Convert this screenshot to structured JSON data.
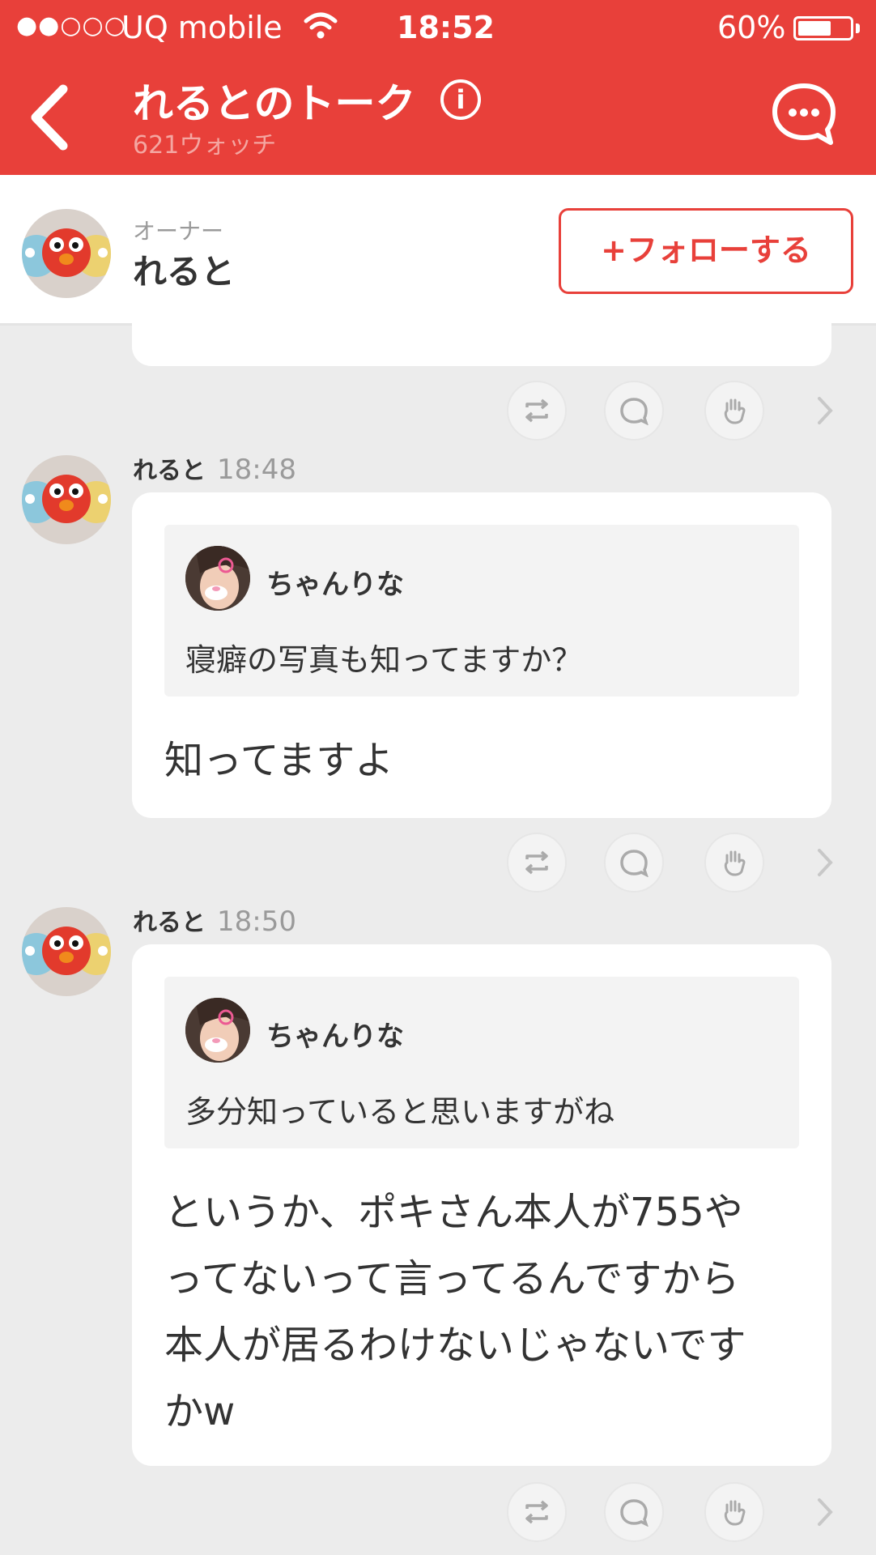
{
  "status_bar": {
    "signal": "●●○○○",
    "carrier": "UQ mobile",
    "time": "18:52",
    "battery": "60%",
    "battery_level": 0.6
  },
  "nav": {
    "title": "れるとのトーク",
    "info_label": "i",
    "subtitle": "621ウォッチ"
  },
  "owner": {
    "role": "オーナー",
    "name": "れると",
    "follow_label": "+フォローする"
  },
  "posts": [
    {
      "author": "れると",
      "time": "18:48",
      "quote": {
        "author": "ちゃんりな",
        "text": "寝癖の写真も知ってますか？"
      },
      "reply_lines": [
        "知ってますよ"
      ]
    },
    {
      "author": "れると",
      "time": "18:50",
      "quote": {
        "author": "ちゃんりな",
        "text": "多分知っていると思いますがね"
      },
      "reply_lines": [
        "というか、ポキさん本人が755や",
        "ってないって言ってるんですから",
        "本人が居るわけないじゃないです",
        "かw"
      ]
    }
  ],
  "colors": {
    "accent": "#e8403a",
    "background": "#ececec"
  },
  "icons": [
    "back-chevron-icon",
    "info-icon",
    "chat-bubble-icon",
    "repost-icon",
    "comment-icon",
    "clap-icon",
    "chevron-right-icon"
  ]
}
